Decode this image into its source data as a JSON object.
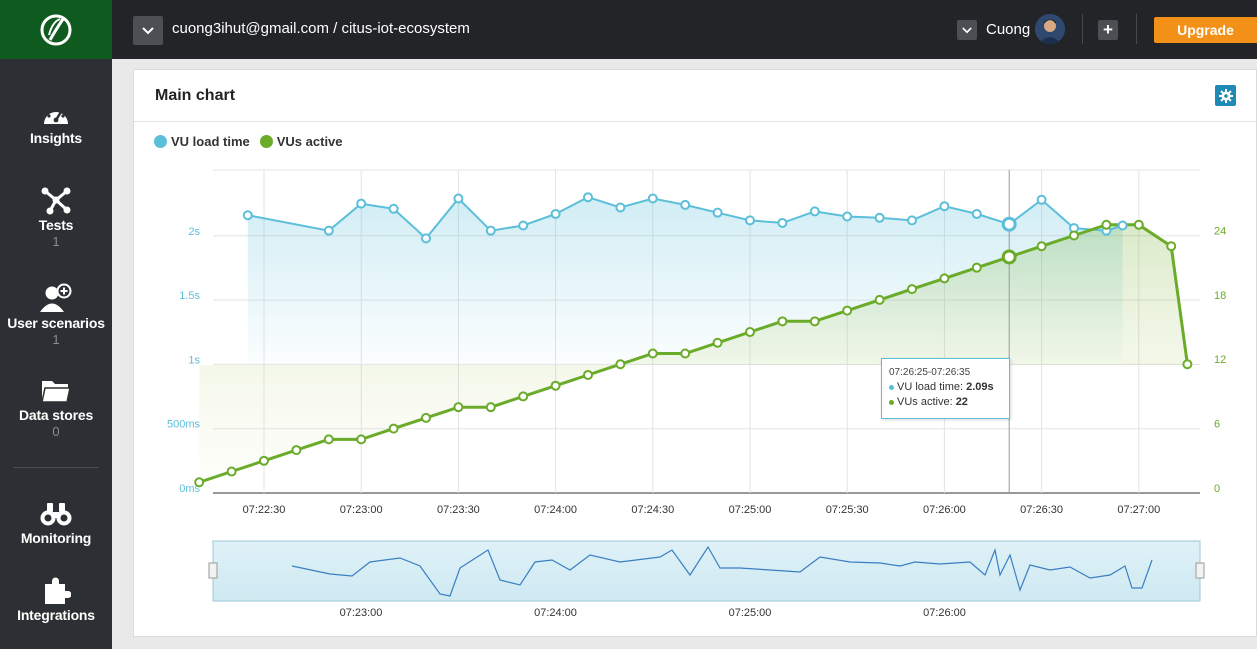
{
  "header": {
    "project_path": "cuong3ihut@gmail.com / citus-iot-ecosystem",
    "user_name": "Cuong",
    "upgrade_label": "Upgrade",
    "add_label": "+"
  },
  "sidebar": {
    "items": [
      {
        "label": "Insights",
        "count": "",
        "icon": "speedometer-icon"
      },
      {
        "label": "Tests",
        "count": "1",
        "icon": "tests-icon"
      },
      {
        "label": "User scenarios",
        "count": "1",
        "icon": "user-add-icon"
      },
      {
        "label": "Data stores",
        "count": "0",
        "icon": "folder-icon"
      },
      {
        "label": "Monitoring",
        "count": "",
        "icon": "binoculars-icon"
      },
      {
        "label": "Integrations",
        "count": "",
        "icon": "puzzle-icon"
      }
    ]
  },
  "panel": {
    "title": "Main chart"
  },
  "tooltip": {
    "time_range": "07:26:25-07:26:35",
    "load_label": "VU load time: ",
    "load_value": "2.09s",
    "vus_label": "VUs active: ",
    "vus_value": "22"
  },
  "colors": {
    "load": "#5bbfd9",
    "vus": "#6aab29",
    "accent": "#f39018",
    "brand": "#0e5a1f"
  },
  "chart_data": {
    "type": "line",
    "x_ticks": [
      "07:22:30",
      "07:23:00",
      "07:23:30",
      "07:24:00",
      "07:24:30",
      "07:25:00",
      "07:25:30",
      "07:26:00",
      "07:26:30",
      "07:27:00"
    ],
    "left_ticks": [
      "0ms",
      "500ms",
      "1s",
      "1.5s",
      "2s"
    ],
    "right_ticks": [
      "0",
      "6",
      "12",
      "18",
      "24"
    ],
    "left_ylim": [
      0,
      2.5
    ],
    "right_ylim": [
      0,
      30
    ],
    "series": [
      {
        "name": "VU load time",
        "axis": "left",
        "unit": "s",
        "points": [
          [
            -5,
            2.16
          ],
          [
            20,
            2.04
          ],
          [
            30,
            2.25
          ],
          [
            40,
            2.21
          ],
          [
            50,
            1.98
          ],
          [
            60,
            2.29
          ],
          [
            70,
            2.04
          ],
          [
            80,
            2.08
          ],
          [
            90,
            2.17
          ],
          [
            100,
            2.3
          ],
          [
            110,
            2.22
          ],
          [
            120,
            2.29
          ],
          [
            130,
            2.24
          ],
          [
            140,
            2.18
          ],
          [
            150,
            2.12
          ],
          [
            160,
            2.1
          ],
          [
            170,
            2.19
          ],
          [
            180,
            2.15
          ],
          [
            190,
            2.14
          ],
          [
            200,
            2.12
          ],
          [
            210,
            2.23
          ],
          [
            220,
            2.17
          ],
          [
            230,
            2.09
          ],
          [
            240,
            2.28
          ],
          [
            250,
            2.06
          ],
          [
            260,
            2.04
          ],
          [
            265,
            2.08
          ]
        ]
      },
      {
        "name": "VUs active",
        "axis": "right",
        "unit": "",
        "points": [
          [
            -20,
            1
          ],
          [
            -10,
            2
          ],
          [
            0,
            3
          ],
          [
            10,
            4
          ],
          [
            20,
            5
          ],
          [
            30,
            5
          ],
          [
            40,
            6
          ],
          [
            50,
            7
          ],
          [
            60,
            8
          ],
          [
            70,
            8
          ],
          [
            80,
            9
          ],
          [
            90,
            10
          ],
          [
            100,
            11
          ],
          [
            110,
            12
          ],
          [
            120,
            13
          ],
          [
            130,
            13
          ],
          [
            140,
            14
          ],
          [
            150,
            15
          ],
          [
            160,
            16
          ],
          [
            170,
            16
          ],
          [
            180,
            17
          ],
          [
            190,
            18
          ],
          [
            200,
            19
          ],
          [
            210,
            20
          ],
          [
            220,
            21
          ],
          [
            230,
            22
          ],
          [
            240,
            23
          ],
          [
            250,
            24
          ],
          [
            260,
            25
          ],
          [
            270,
            25
          ],
          [
            280,
            23
          ],
          [
            285,
            12
          ]
        ]
      }
    ],
    "x_origin_label": "07:22:30",
    "x_spacing_seconds": 30,
    "highlight_x": 230,
    "navigator_ticks": [
      "07:23:00",
      "07:24:00",
      "07:25:00",
      "07:26:00"
    ]
  }
}
